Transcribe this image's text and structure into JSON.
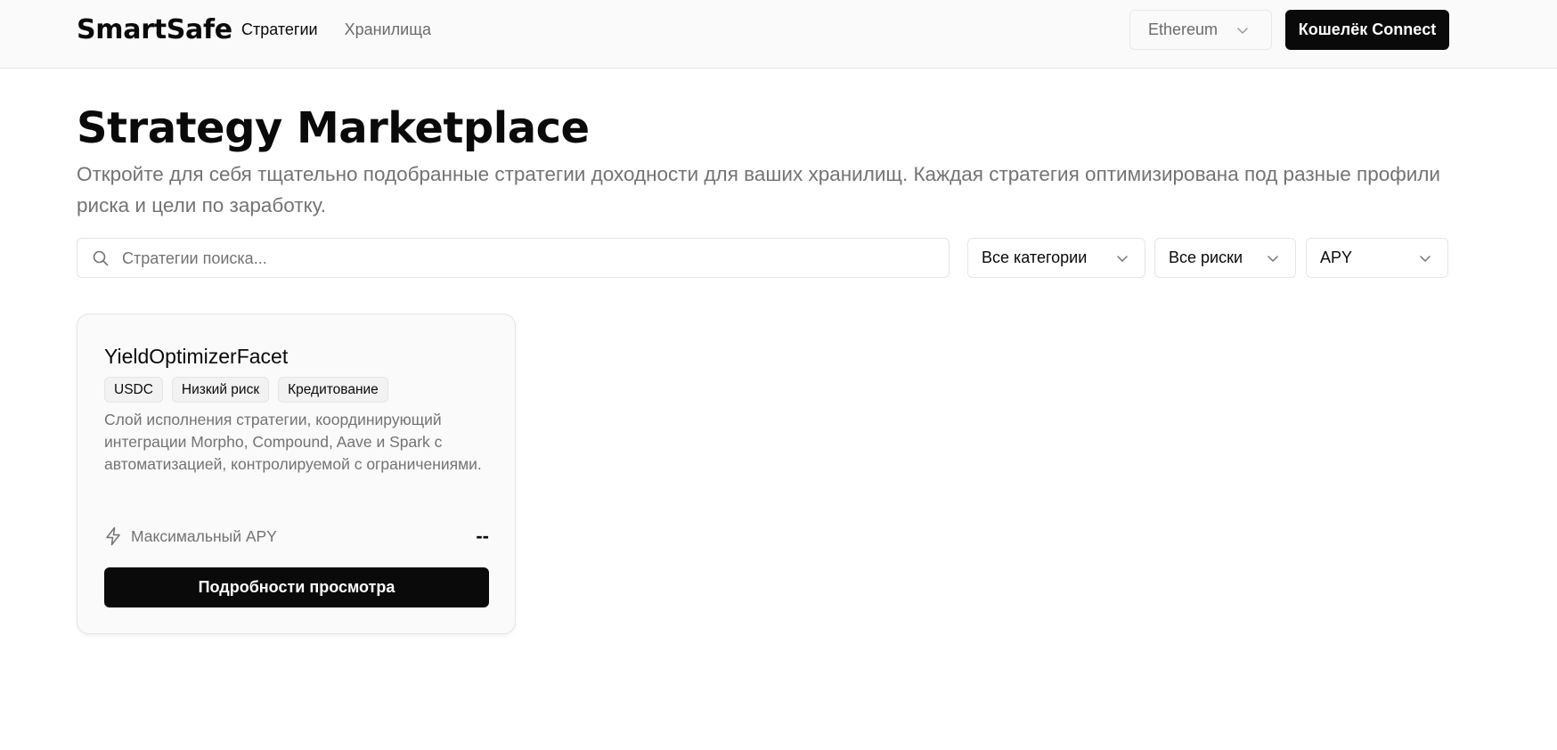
{
  "header": {
    "logo": "SmartSafe",
    "nav": [
      {
        "label": "Стратегии",
        "active": true
      },
      {
        "label": "Хранилища",
        "active": false
      }
    ],
    "network": {
      "value": "Ethereum",
      "icon": "chevron-down-icon"
    },
    "wallet_button": "Кошелёк Connect"
  },
  "hero": {
    "title": "Strategy Marketplace",
    "subtitle": "Откройте для себя тщательно подобранные стратегии доходности для ваших хранилищ. Каждая стратегия оптимизирована под разные профили риска и цели по заработку."
  },
  "filters": {
    "search_placeholder": "Стратегии поиска...",
    "search_icon": "search-icon",
    "category": "Все категории",
    "risk": "Все риски",
    "sort": "APY"
  },
  "strategies": [
    {
      "name": "YieldOptimizerFacet",
      "tags": [
        "USDC",
        "Низкий риск",
        "Кредитование"
      ],
      "description": "Слой исполнения стратегии, координирующий интеграции Morpho, Compound, Aave и Spark с автоматизацией, контролируемой с ограничениями.",
      "apy_label": "Максимальный APY",
      "apy_icon": "bolt-icon",
      "apy_value": "--",
      "button": "Подробности просмотра"
    }
  ],
  "colors": {
    "primary": "#0a0a0a",
    "muted_text": "#737373",
    "border": "#e5e5e5",
    "header_bg": "#fafafa"
  }
}
